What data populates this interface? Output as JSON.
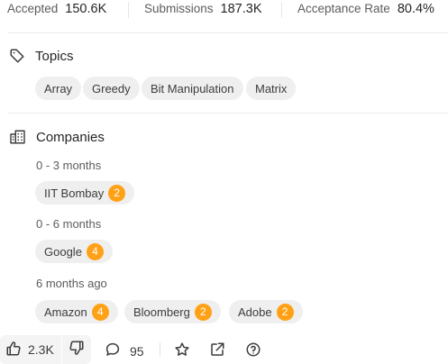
{
  "stats": {
    "accepted": {
      "label": "Accepted",
      "value": "150.6K"
    },
    "submissions": {
      "label": "Submissions",
      "value": "187.3K"
    },
    "acceptance_rate": {
      "label": "Acceptance Rate",
      "value": "80.4%"
    }
  },
  "topics": {
    "title": "Topics",
    "icon": "tag-icon",
    "tags": [
      "Array",
      "Greedy",
      "Bit Manipulation",
      "Matrix"
    ]
  },
  "companies": {
    "title": "Companies",
    "icon": "building-icon",
    "groups": [
      {
        "period": "0 - 3 months",
        "items": [
          {
            "name": "IIT Bombay",
            "count": "2"
          }
        ]
      },
      {
        "period": "0 - 6 months",
        "items": [
          {
            "name": "Google",
            "count": "4"
          }
        ]
      },
      {
        "period": "6 months ago",
        "items": [
          {
            "name": "Amazon",
            "count": "4"
          },
          {
            "name": "Bloomberg",
            "count": "2"
          },
          {
            "name": "Adobe",
            "count": "2"
          }
        ]
      }
    ]
  },
  "footer": {
    "likes": "2.3K",
    "comments": "95"
  },
  "colors": {
    "badge": "#ffa116",
    "chip_bg": "#efefef"
  }
}
